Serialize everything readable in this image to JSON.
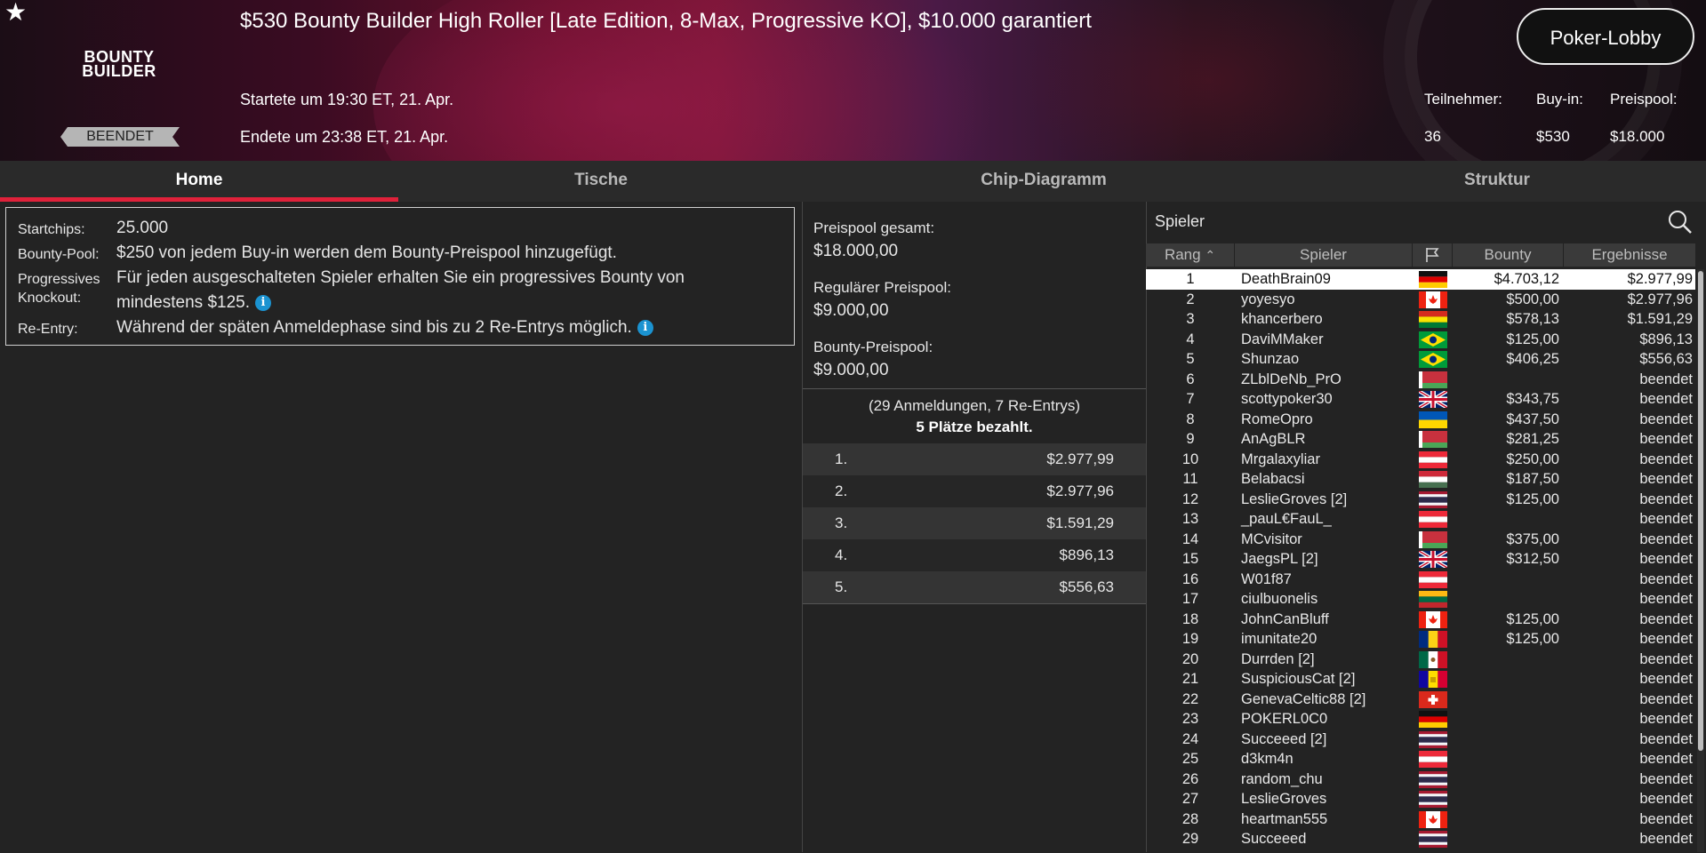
{
  "header": {
    "logo_line1": "BOUNTY",
    "logo_line2": "BUILDER",
    "status": "BEENDET",
    "title": "$530 Bounty Builder High Roller [Late Edition, 8-Max, Progressive KO], $10.000 garantiert",
    "started": "Startete um 19:30 ET, 21. Apr.",
    "ended": "Endete um 23:38 ET, 21. Apr.",
    "lobby_button": "Poker-Lobby",
    "stats": {
      "participants_label": "Teilnehmer:",
      "participants_value": "36",
      "buyin_label": "Buy-in:",
      "buyin_value": "$530",
      "prizepool_label": "Preispool:",
      "prizepool_value": "$18.000"
    }
  },
  "tabs": [
    "Home",
    "Tische",
    "Chip-Diagramm",
    "Struktur"
  ],
  "info": {
    "startchips_label": "Startchips:",
    "startchips_value": "25.000",
    "bountypool_label": "Bounty-Pool:",
    "bountypool_value": "$250 von jedem Buy-in werden dem Bounty-Preispool hinzugefügt.",
    "pko_label_1": "Progressives",
    "pko_label_2": "Knockout:",
    "pko_value_1": "Für jeden ausgeschalteten Spieler erhalten Sie ein progressives Bounty von",
    "pko_value_2": "mindestens $125.",
    "reentry_label": "Re-Entry:",
    "reentry_value": "Während der späten Anmeldephase sind bis zu 2 Re-Entrys möglich."
  },
  "prizepool": {
    "total_label": "Preispool gesamt:",
    "total_value": "$18.000,00",
    "regular_label": "Regulärer Preispool:",
    "regular_value": "$9.000,00",
    "bounty_label": "Bounty-Preispool:",
    "bounty_value": "$9.000,00",
    "entries": "(29 Anmeldungen, 7 Re-Entrys)",
    "paid": "5 Plätze bezahlt.",
    "places": [
      {
        "pos": "1.",
        "amount": "$2.977,99"
      },
      {
        "pos": "2.",
        "amount": "$2.977,96"
      },
      {
        "pos": "3.",
        "amount": "$1.591,29"
      },
      {
        "pos": "4.",
        "amount": "$896,13"
      },
      {
        "pos": "5.",
        "amount": "$556,63"
      }
    ]
  },
  "players": {
    "title": "Spieler",
    "columns": {
      "rank": "Rang",
      "player": "Spieler",
      "bounty": "Bounty",
      "result": "Ergebnisse"
    },
    "rows": [
      {
        "rank": "1",
        "name": "DeathBrain09",
        "flag": "de",
        "bounty": "$4.703,12",
        "result": "$2.977,99"
      },
      {
        "rank": "2",
        "name": "yoyesyo",
        "flag": "ca",
        "bounty": "$500,00",
        "result": "$2.977,96"
      },
      {
        "rank": "3",
        "name": "khancerbero",
        "flag": "bo",
        "bounty": "$578,13",
        "result": "$1.591,29"
      },
      {
        "rank": "4",
        "name": "DaviMMaker",
        "flag": "br",
        "bounty": "$125,00",
        "result": "$896,13"
      },
      {
        "rank": "5",
        "name": "Shunzao",
        "flag": "br",
        "bounty": "$406,25",
        "result": "$556,63"
      },
      {
        "rank": "6",
        "name": "ZLblDeNb_PrO",
        "flag": "by",
        "bounty": "",
        "result": "beendet"
      },
      {
        "rank": "7",
        "name": "scottypoker30",
        "flag": "gb",
        "bounty": "$343,75",
        "result": "beendet"
      },
      {
        "rank": "8",
        "name": "RomeOpro",
        "flag": "ua",
        "bounty": "$437,50",
        "result": "beendet"
      },
      {
        "rank": "9",
        "name": "AnAgBLR",
        "flag": "by",
        "bounty": "$281,25",
        "result": "beendet"
      },
      {
        "rank": "10",
        "name": "Mrgalaxyliar",
        "flag": "at",
        "bounty": "$250,00",
        "result": "beendet"
      },
      {
        "rank": "11",
        "name": "Belabacsi",
        "flag": "hu",
        "bounty": "$187,50",
        "result": "beendet"
      },
      {
        "rank": "12",
        "name": "LeslieGroves [2]",
        "flag": "th",
        "bounty": "$125,00",
        "result": "beendet"
      },
      {
        "rank": "13",
        "name": "_pauL€FauL_",
        "flag": "at",
        "bounty": "",
        "result": "beendet"
      },
      {
        "rank": "14",
        "name": "MCvisitor",
        "flag": "by",
        "bounty": "$375,00",
        "result": "beendet"
      },
      {
        "rank": "15",
        "name": "JaegsPL [2]",
        "flag": "gb",
        "bounty": "$312,50",
        "result": "beendet"
      },
      {
        "rank": "16",
        "name": "W01f87",
        "flag": "at",
        "bounty": "",
        "result": "beendet"
      },
      {
        "rank": "17",
        "name": "ciulbuonelis",
        "flag": "lt",
        "bounty": "",
        "result": "beendet"
      },
      {
        "rank": "18",
        "name": "JohnCanBluff",
        "flag": "ca",
        "bounty": "$125,00",
        "result": "beendet"
      },
      {
        "rank": "19",
        "name": "imunitate20",
        "flag": "ro",
        "bounty": "$125,00",
        "result": "beendet"
      },
      {
        "rank": "20",
        "name": "Durrden [2]",
        "flag": "mx",
        "bounty": "",
        "result": "beendet"
      },
      {
        "rank": "21",
        "name": "SuspiciousCat [2]",
        "flag": "ad",
        "bounty": "",
        "result": "beendet"
      },
      {
        "rank": "22",
        "name": "GenevaCeltic88 [2]",
        "flag": "ch",
        "bounty": "",
        "result": "beendet"
      },
      {
        "rank": "23",
        "name": "POKERL0C0",
        "flag": "de",
        "bounty": "",
        "result": "beendet"
      },
      {
        "rank": "24",
        "name": "Succeeed [2]",
        "flag": "th",
        "bounty": "",
        "result": "beendet"
      },
      {
        "rank": "25",
        "name": "d3km4n",
        "flag": "at",
        "bounty": "",
        "result": "beendet"
      },
      {
        "rank": "26",
        "name": "random_chu",
        "flag": "th",
        "bounty": "",
        "result": "beendet"
      },
      {
        "rank": "27",
        "name": "LeslieGroves",
        "flag": "th",
        "bounty": "",
        "result": "beendet"
      },
      {
        "rank": "28",
        "name": "heartman555",
        "flag": "ca",
        "bounty": "",
        "result": "beendet"
      },
      {
        "rank": "29",
        "name": "Succeeed",
        "flag": "th",
        "bounty": "",
        "result": "beendet"
      }
    ]
  }
}
